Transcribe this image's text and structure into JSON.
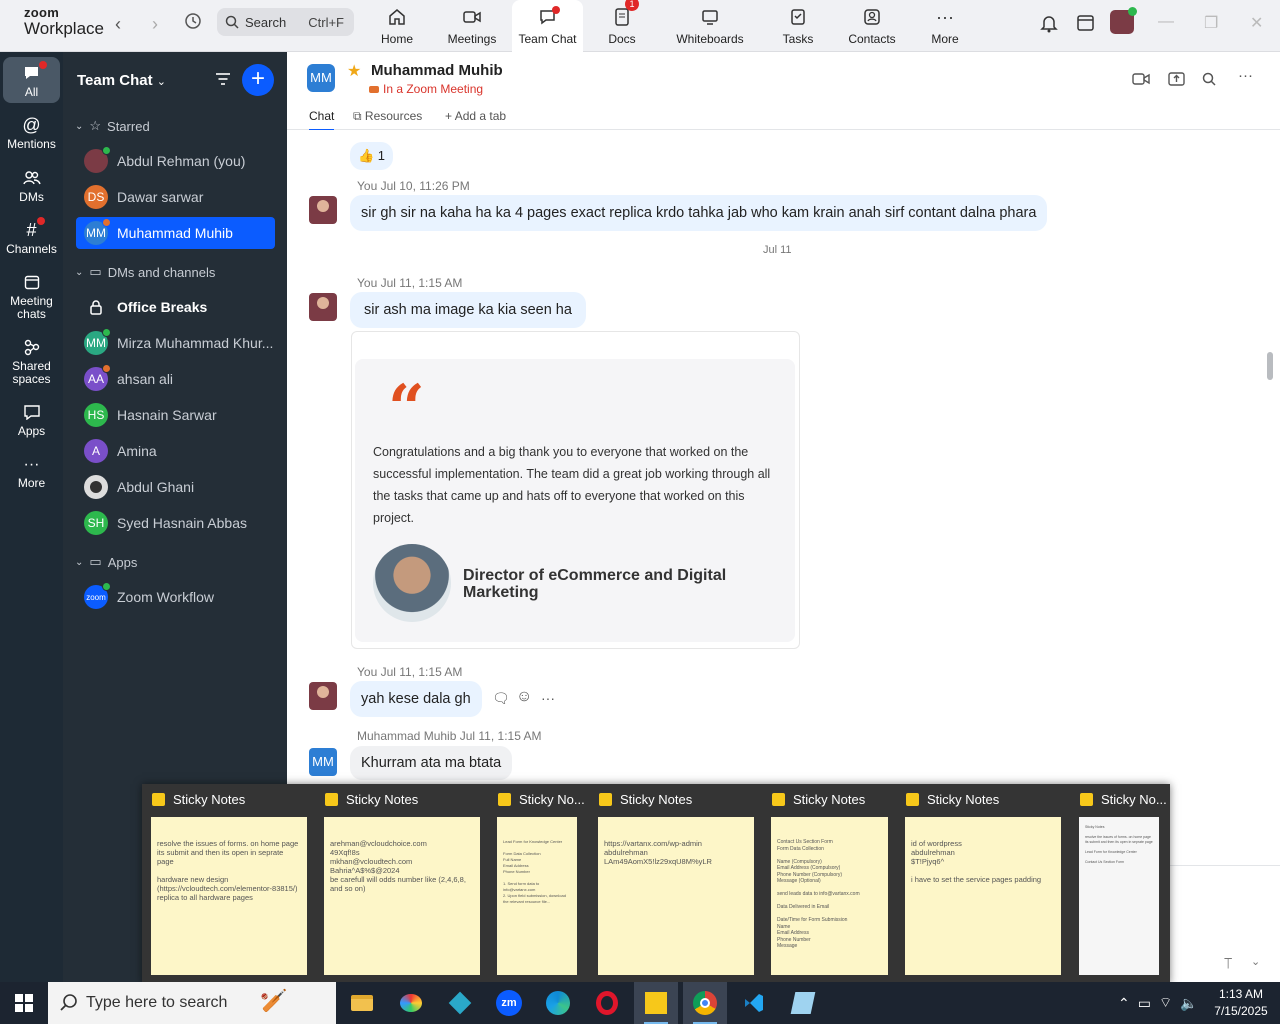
{
  "app": {
    "logo_line1": "zoom",
    "logo_line2": "Workplace"
  },
  "search": {
    "label": "Search",
    "shortcut": "Ctrl+F"
  },
  "toptabs": [
    {
      "label": "Home",
      "icon": "home-icon"
    },
    {
      "label": "Meetings",
      "icon": "video-camera-icon"
    },
    {
      "label": "Team Chat",
      "icon": "chat-bubble-icon",
      "active": true
    },
    {
      "label": "Docs",
      "icon": "document-icon",
      "badge": "1"
    },
    {
      "label": "Whiteboards",
      "icon": "whiteboard-icon"
    },
    {
      "label": "Tasks",
      "icon": "tasks-icon"
    },
    {
      "label": "Contacts",
      "icon": "contacts-icon"
    },
    {
      "label": "More",
      "icon": "more-dots-icon"
    }
  ],
  "rail": [
    {
      "label": "All",
      "active": true
    },
    {
      "label": "Mentions"
    },
    {
      "label": "DMs"
    },
    {
      "label": "Channels"
    },
    {
      "label": "Meeting chats"
    },
    {
      "label": "Shared spaces"
    },
    {
      "label": "Apps"
    },
    {
      "label": "More"
    }
  ],
  "sidebar": {
    "title": "Team Chat",
    "sections": {
      "starred": "Starred",
      "dms": "DMs and channels",
      "apps": "Apps"
    },
    "starred": [
      {
        "name": "Abdul Rehman (you)",
        "initials": "",
        "color": "#7b3b45",
        "status": "#2db84d"
      },
      {
        "name": "Dawar sarwar",
        "initials": "DS",
        "color": "#e2702e",
        "status": ""
      },
      {
        "name": "Muhammad Muhib",
        "initials": "MM",
        "color": "#2d7ed4",
        "status": "#e2702e",
        "active": true
      }
    ],
    "dms": [
      {
        "name": "Office Breaks",
        "initials": "",
        "color": "",
        "status": "",
        "channel": true
      },
      {
        "name": "Mirza Muhammad Khur...",
        "initials": "MM",
        "color": "#2aa882",
        "status": "#2db84d"
      },
      {
        "name": "ahsan ali",
        "initials": "AA",
        "color": "#7a4fc9",
        "status": "#e2702e"
      },
      {
        "name": "Hasnain Sarwar",
        "initials": "HS",
        "color": "#2db84d",
        "status": ""
      },
      {
        "name": "Amina",
        "initials": "A",
        "color": "#7a4fc9",
        "status": ""
      },
      {
        "name": "Abdul Ghani",
        "initials": "",
        "color": "#555",
        "status": ""
      },
      {
        "name": "Syed Hasnain Abbas",
        "initials": "SH",
        "color": "#2db84d",
        "status": ""
      }
    ],
    "apps": [
      {
        "name": "Zoom Workflow",
        "initials": "zoom",
        "color": "#0b5cff",
        "status": ""
      }
    ]
  },
  "chat": {
    "initials": "MM",
    "name": "Muhammad Muhib",
    "status": "In a Zoom Meeting",
    "tabs": {
      "chat": "Chat",
      "resources": "Resources",
      "add": "Add a tab"
    }
  },
  "messages": {
    "reaction": "👍 1",
    "m1_meta": "You Jul 10, 11:26 PM",
    "m1_text": "sir gh sir na kaha ha ka 4 pages exact replica krdo tahka jab who kam krain anah sirf contant dalna phara",
    "date_sep": "Jul 11",
    "m2_meta": "You Jul 11, 1:15 AM",
    "m2_text": "sir ash ma image ka kia seen ha",
    "card_quote": "Congratulations and a big thank you to everyone that worked on the successful implementation. The team did a great job working through all the tasks that came up and hats off to everyone that worked on this project.",
    "card_name": "Director of eCommerce and Digital Marketing",
    "m3_meta": "You Jul 11, 1:15 AM",
    "m3_text": "yah kese dala gh",
    "m4_sender": "Muhammad Muhib",
    "m4_time": "Jul 11, 1:15 AM",
    "m4_text": "Khurram ata ma btata",
    "m4_initials": "MM"
  },
  "sticky_previews": [
    {
      "title": "Sticky Notes",
      "body": "resolve the issues of forms. on home page its submit and then its open in seprate page\n\nhardware new design\n(https://vcloudtech.com/elementor-83815/)\nreplica to all hardware pages"
    },
    {
      "title": "Sticky Notes",
      "body": "arehman@vcloudchoice.com\n49Xqf!8s\nmkhan@vcloudtech.com\nBahria^A$%$@2024\nbe carefull will odds number like (2,4,6,8, and so on)"
    },
    {
      "title": "Sticky No...",
      "body": "Lead Form for Knowledge Center\n\nForm Data Collection\nFull Name\nEmail Address\nPhone Number\n\n1. Send form data to info@vartanx.com\n2. Upon field submission, download the relevant resource file..."
    },
    {
      "title": "Sticky Notes",
      "body": "https://vartanx.com/wp-admin\nabdulrehman\nLAm49AomX5!lz29xqU8M%yLR"
    },
    {
      "title": "Sticky Notes",
      "body": "Contact Us Section Form\nForm Data Collection\n\nName (Compulsory)\nEmail Address (Compulsory)\nPhone Number (Compulsory)\nMessage (Optional)\n\nsend leads data to info@vartanx.com\n\nData Delivered in Email\n\nDate/Time for Form Submission\nName\nEmail Address\nPhone Number\nMessage"
    },
    {
      "title": "Sticky Notes",
      "body": "id of wordpress\nabdulrehman\n$T!Pjyq6^\n\ni have to set the service pages padding"
    },
    {
      "title": "Sticky No...",
      "body": "Sticky Notes\n\nresolve the issues of forms. on home page its submit and then its open in seprate page\n\nLead Form for Knowledge Center\n\nContact Us Section Form"
    }
  ],
  "taskbar": {
    "search_placeholder": "Type here to search",
    "time": "1:13 AM",
    "date": "7/15/2025"
  }
}
